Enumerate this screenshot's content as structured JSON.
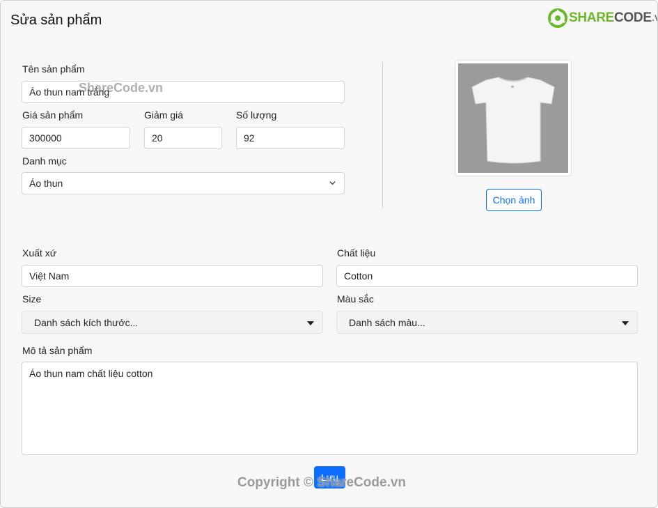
{
  "modal": {
    "title": "Sửa sản phẩm"
  },
  "logo": {
    "part1": "SHARE",
    "part2": "CODE",
    "part3": ".vn"
  },
  "form": {
    "name": {
      "label": "Tên sản phẩm",
      "value": "Áo thun nam trắng"
    },
    "price": {
      "label": "Giá sản phẩm",
      "value": "300000"
    },
    "discount": {
      "label": "Giảm giá",
      "value": "20"
    },
    "quantity": {
      "label": "Số lượng",
      "value": "92"
    },
    "category": {
      "label": "Danh mục",
      "value": "Áo thun"
    },
    "origin": {
      "label": "Xuất xứ",
      "value": "Việt Nam"
    },
    "material": {
      "label": "Chất liệu",
      "value": "Cotton"
    },
    "size": {
      "label": "Size",
      "value": "Danh sách kích thước..."
    },
    "color": {
      "label": "Màu sắc",
      "value": "Danh sách màu..."
    },
    "description": {
      "label": "Mô tả sản phẩm",
      "value": "Áo thun nam chất liệu cotton"
    }
  },
  "image": {
    "choose_label": "Chọn ảnh",
    "icon": "t-shirt-photo"
  },
  "actions": {
    "save_label": "Lưu"
  },
  "watermarks": {
    "top": "ShareCode.vn",
    "bottom": "Copyright © ShareCode.vn"
  },
  "colors": {
    "primary": "#0d6efd",
    "logo_green": "#6ab825",
    "background": "#f7f7f7"
  }
}
